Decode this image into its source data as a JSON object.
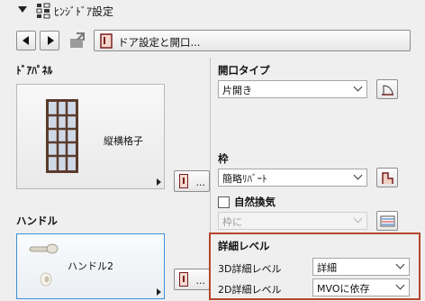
{
  "header": {
    "title": "ﾋﾝｼﾞﾄﾞｱ設定"
  },
  "toolbar": {
    "settings_label": "ドア設定と開口..."
  },
  "door_panel": {
    "heading": "ﾄﾞｱﾊﾟﾈﾙ",
    "style_label": "縦横格子",
    "more_label": "..."
  },
  "handle": {
    "heading": "ハンドル",
    "style_label": "ハンドル2",
    "more_label": "..."
  },
  "opening_type": {
    "heading": "開口タイプ",
    "value": "片開き"
  },
  "frame": {
    "heading": "枠",
    "value": "簡略ﾘﾊﾞｰﾄ",
    "natural_ventilation_label": "自然換気",
    "natural_ventilation_checked": false,
    "ventilation_select_value": "枠に"
  },
  "detail_level": {
    "heading": "詳細レベル",
    "rows": [
      {
        "label": "3D詳細レベル",
        "value": "詳細"
      },
      {
        "label": "2D詳細レベル",
        "value": "MVOに依存"
      }
    ]
  },
  "colors": {
    "highlight_border": "#b5462b",
    "selected_panel_border": "#3c8fd6",
    "background": "#efefef"
  }
}
